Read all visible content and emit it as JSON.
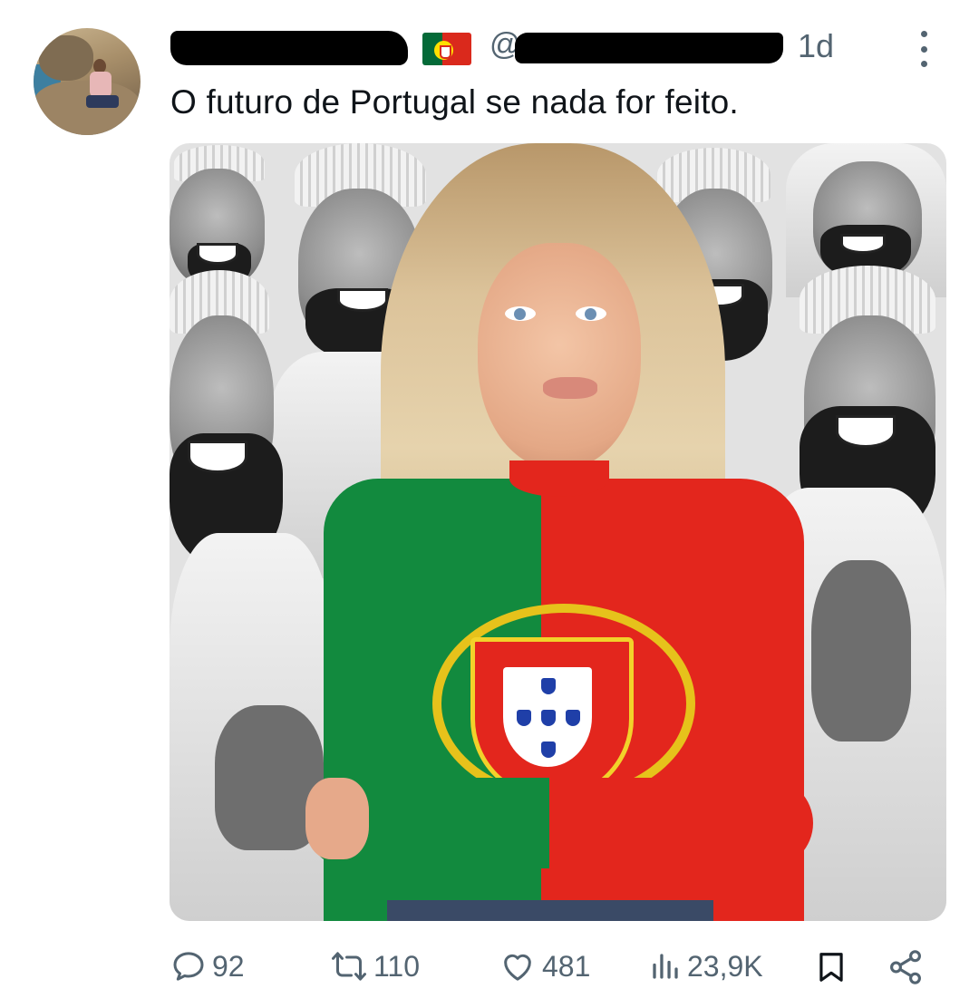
{
  "post": {
    "author": {
      "name_redacted": true,
      "handle_prefix": "@",
      "flag_icon": "portugal-flag-icon"
    },
    "time": "1d",
    "text": "O futuro de Portugal se nada for feito."
  },
  "actions": {
    "replies": "92",
    "reposts": "110",
    "likes": "481",
    "views": "23,9K"
  },
  "colors": {
    "muted": "#536471",
    "text": "#0f1419",
    "flag_green": "#046a38",
    "flag_red": "#da291c"
  }
}
